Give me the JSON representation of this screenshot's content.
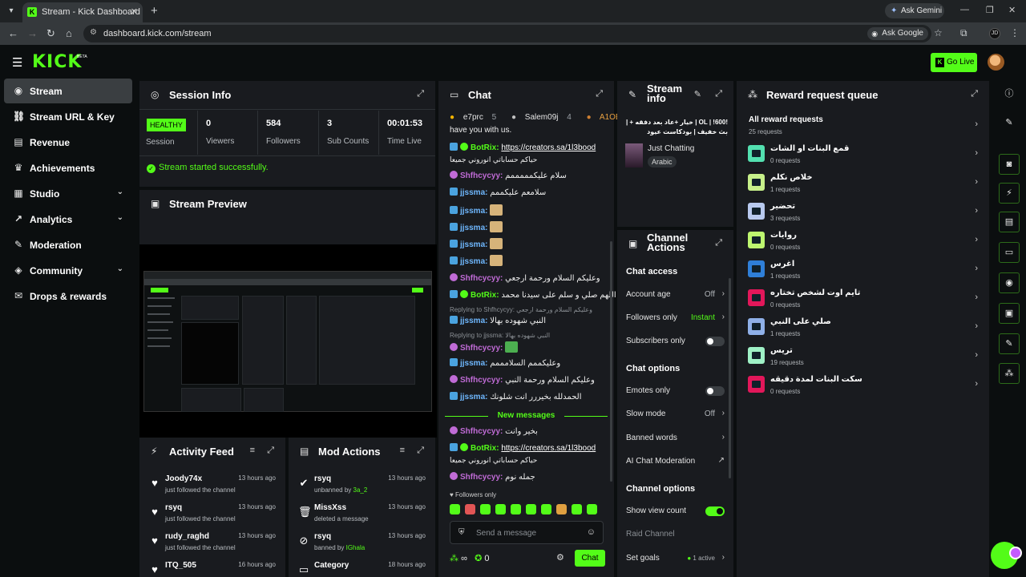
{
  "browser": {
    "tab_title": "Stream - Kick Dashboard",
    "url": "dashboard.kick.com/stream",
    "ask_gemini": "Ask Gemini",
    "ask_google": "Ask Google",
    "profile_initials": "JD"
  },
  "app": {
    "logo": "KICK",
    "beta": "BETA",
    "go_live": "Go Live",
    "accent": "#53fc18"
  },
  "sidebar": {
    "items": [
      {
        "label": "Stream",
        "icon": "stream-icon"
      },
      {
        "label": "Stream URL & Key",
        "icon": "link-icon"
      },
      {
        "label": "Revenue",
        "icon": "revenue-icon"
      },
      {
        "label": "Achievements",
        "icon": "trophy-icon"
      },
      {
        "label": "Studio",
        "icon": "studio-icon"
      },
      {
        "label": "Analytics",
        "icon": "analytics-icon"
      },
      {
        "label": "Moderation",
        "icon": "wrench-icon"
      },
      {
        "label": "Community",
        "icon": "community-icon"
      },
      {
        "label": "Drops & rewards",
        "icon": "gift-icon"
      }
    ]
  },
  "session": {
    "title": "Session Info",
    "health": "HEALTHY",
    "health_label": "Session",
    "stats": [
      {
        "value": "0",
        "label": "Viewers"
      },
      {
        "value": "584",
        "label": "Followers"
      },
      {
        "value": "3",
        "label": "Sub Counts"
      },
      {
        "value": "00:01:53",
        "label": "Time Live"
      }
    ],
    "success": "Stream started successfully."
  },
  "preview": {
    "title": "Stream Preview"
  },
  "activity": {
    "title": "Activity Feed",
    "rows": [
      {
        "name": "Joody74x",
        "sub": "just followed the channel",
        "time": "13 hours ago"
      },
      {
        "name": "rsyq",
        "sub": "just followed the channel",
        "time": "13 hours ago"
      },
      {
        "name": "rudy_raghd",
        "sub": "just followed the channel",
        "time": "13 hours ago"
      },
      {
        "name": "ITQ_505",
        "sub": "",
        "time": "16 hours ago"
      }
    ]
  },
  "mod": {
    "title": "Mod Actions",
    "rows": [
      {
        "name": "rsyq",
        "sub": "unbanned by",
        "by": "3a_2",
        "time": "13 hours ago"
      },
      {
        "name": "MissXss",
        "sub": "deleted a message",
        "by": "",
        "time": "13 hours ago"
      },
      {
        "name": "rsyq",
        "sub": "banned by",
        "by": "IGhala",
        "time": "13 hours ago"
      },
      {
        "name": "Category",
        "sub": "",
        "by": "",
        "time": "18 hours ago"
      }
    ]
  },
  "chat": {
    "title": "Chat",
    "top_chatters": [
      {
        "name": "e7prc",
        "n": "5"
      },
      {
        "name": "Salem09j",
        "n": "4"
      },
      {
        "name": "A1OEM",
        "n": ""
      }
    ],
    "partial_top": "have you with us.",
    "messages": [
      {
        "user": "BotRix:",
        "link": "https://creators.sa/1l3bood",
        "text2": "حياكم حساباتي انوروني جميعا"
      },
      {
        "user": "Shfhcycyy:",
        "text": "سلام عليكمممممم"
      },
      {
        "user": "jjssma:",
        "text": "سلامعم عليكممم"
      },
      {
        "user": "jjssma:",
        "text": ""
      },
      {
        "user": "jjssma:",
        "text": ""
      },
      {
        "user": "jjssma:",
        "text": ""
      },
      {
        "user": "jjssma:",
        "text": ""
      },
      {
        "user": "Shfhcycyy:",
        "text": "وعليكم السلام ورحمة ارجعي"
      },
      {
        "user": "BotRix:",
        "text": "اللهم صلي و سلم على سيدنا محمد"
      },
      {
        "reply": "Replying to Shfhcycyy: وعليكم السلام ورحمة ارجعي"
      },
      {
        "user": "jjssma:",
        "text": "النبي شهوده بهالا"
      },
      {
        "reply": "Replying to jjssma: النبي شهوده بهالا"
      },
      {
        "user": "Shfhcycyy:",
        "text": ""
      },
      {
        "user": "jjssma:",
        "text": "وعليكممم السلامممم"
      },
      {
        "user": "Shfhcycyy:",
        "text": "وعليكم السلام ورحمة النبي"
      },
      {
        "user": "jjssma:",
        "text": "الحمدلله بخيررر انت شلونك"
      }
    ],
    "new_messages": "New messages",
    "after": [
      {
        "user": "Shfhcycyy:",
        "text": "بخير وانت"
      },
      {
        "user": "BotRix:",
        "link": "https://creators.sa/1l3bood",
        "text2": "حياكم حساباتي انوروني جميعا"
      },
      {
        "user": "Shfhcycyy:",
        "text": "جمله نوم"
      }
    ],
    "followers_only": "Followers only",
    "placeholder": "Send a message",
    "chat_btn": "Chat",
    "points": "0"
  },
  "stream_info": {
    "title": "Stream info",
    "stream_title": "!OL | !600 | خيار +عاد بعد دفقه + | بث خفيف | بودكاست عيود",
    "category": "Just Chatting",
    "tag": "Arabic"
  },
  "channel_actions": {
    "title": "Channel Actions",
    "chat_access": "Chat access",
    "account_age": "Account age",
    "account_age_val": "Off",
    "followers_only": "Followers only",
    "followers_only_val": "Instant",
    "subscribers_only": "Subscribers only",
    "chat_options": "Chat options",
    "emotes_only": "Emotes only",
    "slow_mode": "Slow mode",
    "slow_mode_val": "Off",
    "banned_words": "Banned words",
    "ai_mod": "AI Chat Moderation",
    "channel_options": "Channel options",
    "show_view_count": "Show view count",
    "raid_channel": "Raid Channel",
    "set_goals": "Set goals",
    "set_goals_val": "1 active"
  },
  "rewards": {
    "title": "Reward request queue",
    "all": "All reward requests",
    "all_count": "25 requests",
    "items": [
      {
        "name": "قمع البنات او الشات",
        "count": "0 requests",
        "color": "#53e0b0"
      },
      {
        "name": "خلاص نكلم",
        "count": "1 requests",
        "color": "#c7f08a"
      },
      {
        "name": "تحضير",
        "count": "3 requests",
        "color": "#b8c9ee"
      },
      {
        "name": "روايات",
        "count": "0 requests",
        "color": "#bdf56f"
      },
      {
        "name": "اغرس",
        "count": "1 requests",
        "color": "#2f7fd8"
      },
      {
        "name": "تايم اوت لشخص تختاره",
        "count": "0 requests",
        "color": "#e2175a"
      },
      {
        "name": "صلي على النبي",
        "count": "1 requests",
        "color": "#8fb0e8"
      },
      {
        "name": "تريس",
        "count": "19 requests",
        "color": "#9ff1c6"
      },
      {
        "name": "سكت البنات لمدة دقيقه",
        "count": "0 requests",
        "color": "#e2175a"
      }
    ]
  }
}
